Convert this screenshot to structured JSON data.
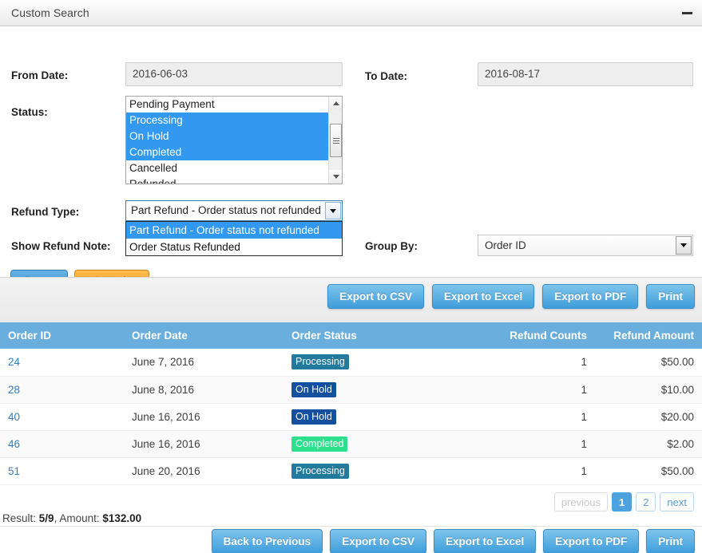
{
  "window": {
    "title": "Custom Search",
    "minimize_icon": "minimize-icon"
  },
  "form": {
    "from_date_label": "From Date:",
    "from_date_value": "2016-06-03",
    "to_date_label": "To Date:",
    "to_date_value": "2016-08-17",
    "status_label": "Status:",
    "status_options": [
      {
        "label": "Pending Payment",
        "selected": false
      },
      {
        "label": "Processing",
        "selected": true
      },
      {
        "label": "On Hold",
        "selected": true
      },
      {
        "label": "Completed",
        "selected": true
      },
      {
        "label": "Cancelled",
        "selected": false
      },
      {
        "label": "Refunded",
        "selected": false
      }
    ],
    "refund_type_label": "Refund Type:",
    "refund_type_value": "Part Refund - Order status not refunded",
    "refund_type_options": [
      {
        "label": "Part Refund - Order status not refunded",
        "highlighted": true
      },
      {
        "label": "Order Status Refunded",
        "highlighted": false
      }
    ],
    "show_refund_note_label": "Show Refund Note:",
    "group_by_label": "Group By:",
    "group_by_value": "Order ID",
    "reset_label": "Reset",
    "search_label": "Search"
  },
  "toolbar": {
    "export_csv": "Export to CSV",
    "export_excel": "Export to Excel",
    "export_pdf": "Export to PDF",
    "print": "Print"
  },
  "table": {
    "columns": [
      "Order ID",
      "Order Date",
      "Order Status",
      "Refund Counts",
      "Refund Amount"
    ],
    "rows": [
      {
        "order_id": "24",
        "order_date": "June 7, 2016",
        "status": "Processing",
        "status_class": "processing",
        "refund_counts": "1",
        "refund_amount": "$50.00"
      },
      {
        "order_id": "28",
        "order_date": "June 8, 2016",
        "status": "On Hold",
        "status_class": "onhold",
        "refund_counts": "1",
        "refund_amount": "$10.00"
      },
      {
        "order_id": "40",
        "order_date": "June 16, 2016",
        "status": "On Hold",
        "status_class": "onhold",
        "refund_counts": "1",
        "refund_amount": "$20.00"
      },
      {
        "order_id": "46",
        "order_date": "June 16, 2016",
        "status": "Completed",
        "status_class": "completed",
        "refund_counts": "1",
        "refund_amount": "$2.00"
      },
      {
        "order_id": "51",
        "order_date": "June 20, 2016",
        "status": "Processing",
        "status_class": "processing",
        "refund_counts": "1",
        "refund_amount": "$50.00"
      }
    ]
  },
  "pagination": {
    "previous": "previous",
    "pages": [
      "1",
      "2"
    ],
    "current_page": "1",
    "next": "next"
  },
  "footer": {
    "result_prefix": "Result: ",
    "result_count": "5/9",
    "amount_prefix": ", Amount: ",
    "amount_value": "$132.00",
    "back_to_previous": "Back to Previous",
    "export_csv": "Export to CSV",
    "export_excel": "Export to Excel",
    "export_pdf": "Export to PDF",
    "print": "Print"
  },
  "colors": {
    "select_blue": "#3399f0",
    "header_blue": "#6aaedd",
    "button_blue": "#3f9ddb",
    "search_orange": "#f08b1d",
    "status_processing": "#227a9c",
    "status_onhold": "#14509f",
    "status_completed": "#2ee08d",
    "link_blue": "#2e7fc4"
  }
}
